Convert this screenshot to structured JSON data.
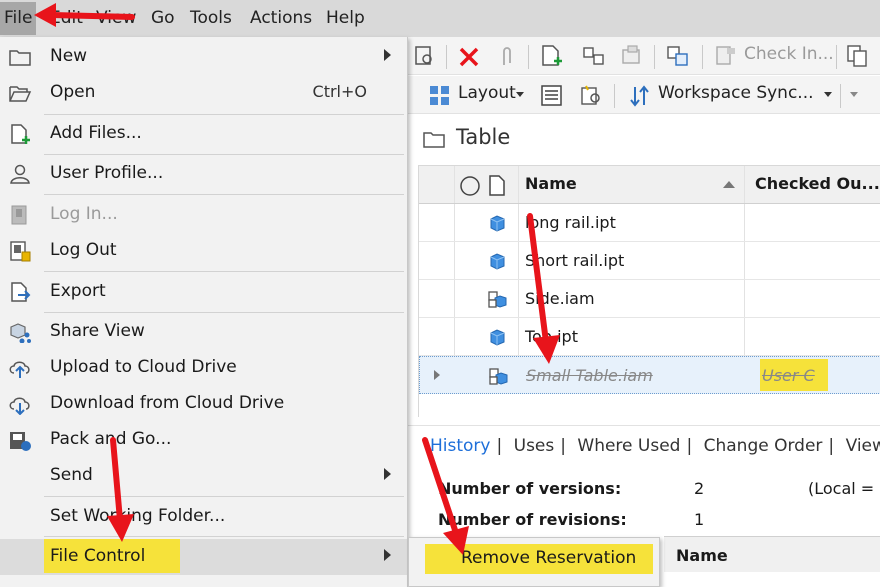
{
  "menubar": {
    "items": [
      "File",
      "Edit",
      "View",
      "Go",
      "Tools",
      "Actions",
      "Help"
    ]
  },
  "toolbar": {
    "check_in": "Check In...",
    "layout": "Layout",
    "workspace_sync": "Workspace Sync..."
  },
  "pane": {
    "title": "Table",
    "columns": {
      "name": "Name",
      "checked_out": "Checked Ou..."
    },
    "rows": [
      {
        "name": "long rail.ipt",
        "checked_out": "",
        "icon": "part-icon"
      },
      {
        "name": "Short rail.ipt",
        "checked_out": "",
        "icon": "part-icon"
      },
      {
        "name": "Side.iam",
        "checked_out": "",
        "icon": "assembly-icon"
      },
      {
        "name": "Top.ipt",
        "checked_out": "",
        "icon": "part-icon"
      },
      {
        "name": "Small Table.iam",
        "checked_out": "User C",
        "icon": "assembly-icon"
      }
    ]
  },
  "details": {
    "tabs": [
      "History",
      "Uses",
      "Where Used",
      "Change Order",
      "View"
    ],
    "versions_label": "Number of versions:",
    "versions_value": "2",
    "revisions_label": "Number of revisions:",
    "revisions_value": "1",
    "local_label": "(Local =",
    "name_col": "Name"
  },
  "file_menu": {
    "items": [
      {
        "label": "New",
        "shortcut": "",
        "submenu": true,
        "disabled": false,
        "icon": "folder-new-icon"
      },
      {
        "label": "Open",
        "shortcut": "Ctrl+O",
        "submenu": false,
        "disabled": false,
        "icon": "folder-open-icon"
      },
      {
        "label": "Add Files...",
        "shortcut": "",
        "submenu": false,
        "disabled": false,
        "icon": "add-file-icon"
      },
      {
        "label": "User Profile...",
        "shortcut": "",
        "submenu": false,
        "disabled": false,
        "icon": "user-icon"
      },
      {
        "label": "Log In...",
        "shortcut": "",
        "submenu": false,
        "disabled": true,
        "icon": "login-icon"
      },
      {
        "label": "Log Out",
        "shortcut": "",
        "submenu": false,
        "disabled": false,
        "icon": "logout-icon"
      },
      {
        "label": "Export",
        "shortcut": "",
        "submenu": false,
        "disabled": false,
        "icon": "export-icon"
      },
      {
        "label": "Share View",
        "shortcut": "",
        "submenu": false,
        "disabled": false,
        "icon": "share-view-icon"
      },
      {
        "label": "Upload to Cloud Drive",
        "shortcut": "",
        "submenu": false,
        "disabled": false,
        "icon": "cloud-upload-icon"
      },
      {
        "label": "Download from Cloud Drive",
        "shortcut": "",
        "submenu": false,
        "disabled": false,
        "icon": "cloud-download-icon"
      },
      {
        "label": "Pack and Go...",
        "shortcut": "",
        "submenu": false,
        "disabled": false,
        "icon": "pack-and-go-icon"
      },
      {
        "label": "Send",
        "shortcut": "",
        "submenu": true,
        "disabled": false,
        "icon": ""
      },
      {
        "label": "Set Working Folder...",
        "shortcut": "",
        "submenu": false,
        "disabled": false,
        "icon": ""
      },
      {
        "label": "File Control",
        "shortcut": "",
        "submenu": true,
        "disabled": false,
        "icon": ""
      }
    ]
  },
  "submenu": {
    "label": "Remove Reservation"
  },
  "colors": {
    "highlight": "#f6e23a",
    "annotation": "#e8141b",
    "link": "#1e6fd9"
  }
}
